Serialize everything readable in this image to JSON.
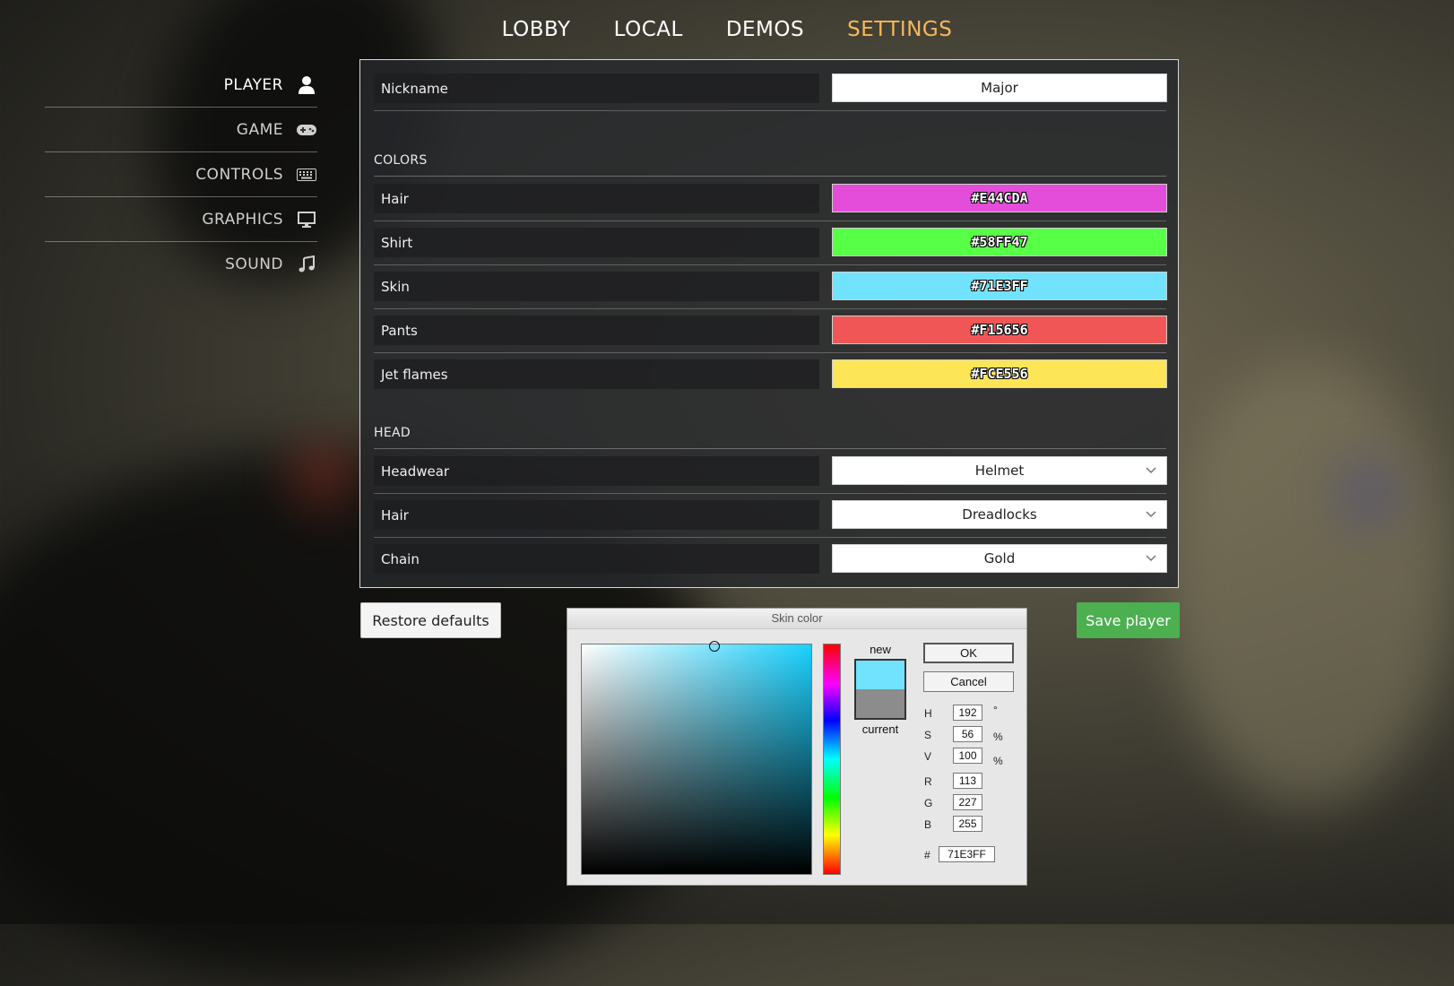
{
  "nav": {
    "tabs": [
      {
        "label": "LOBBY"
      },
      {
        "label": "LOCAL"
      },
      {
        "label": "DEMOS"
      },
      {
        "label": "SETTINGS"
      }
    ]
  },
  "sidebar": {
    "items": [
      {
        "label": "PLAYER",
        "icon": "user-icon"
      },
      {
        "label": "GAME",
        "icon": "gamepad-icon"
      },
      {
        "label": "CONTROLS",
        "icon": "keyboard-icon"
      },
      {
        "label": "GRAPHICS",
        "icon": "monitor-icon"
      },
      {
        "label": "SOUND",
        "icon": "music-icon"
      }
    ]
  },
  "player": {
    "nickname_label": "Nickname",
    "nickname_value": "Major",
    "colors_heading": "COLORS",
    "colors": [
      {
        "label": "Hair",
        "value": "#E44CDA"
      },
      {
        "label": "Shirt",
        "value": "#58FF47"
      },
      {
        "label": "Skin",
        "value": "#71E3FF"
      },
      {
        "label": "Pants",
        "value": "#F15656"
      },
      {
        "label": "Jet flames",
        "value": "#FCE556"
      }
    ],
    "head_heading": "HEAD",
    "head": [
      {
        "label": "Headwear",
        "value": "Helmet"
      },
      {
        "label": "Hair",
        "value": "Dreadlocks"
      },
      {
        "label": "Chain",
        "value": "Gold"
      }
    ]
  },
  "buttons": {
    "restore": "Restore defaults",
    "save": "Save player"
  },
  "color_dialog": {
    "title": "Skin color",
    "new_label": "new",
    "current_label": "current",
    "new_color": "#71E3FF",
    "current_color": "#8C8C8C",
    "ok": "OK",
    "cancel": "Cancel",
    "fields": {
      "h": {
        "label": "H",
        "value": "192",
        "unit": "°"
      },
      "s": {
        "label": "S",
        "value": "56",
        "unit": "%"
      },
      "v": {
        "label": "V",
        "value": "100",
        "unit": "%"
      },
      "r": {
        "label": "R",
        "value": "113"
      },
      "g": {
        "label": "G",
        "value": "227"
      },
      "b": {
        "label": "B",
        "value": "255"
      }
    },
    "hex_label": "#",
    "hex_value": "71E3FF"
  },
  "colors": {
    "accent_active_tab": "#F7B85C",
    "save_button": "#4CAF50"
  }
}
